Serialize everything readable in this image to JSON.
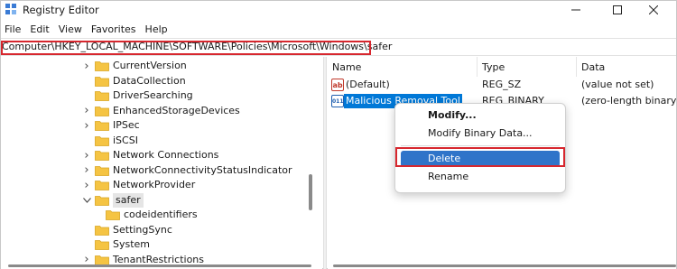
{
  "window": {
    "title": "Registry Editor",
    "minimize_glyph": "—",
    "maximize_glyph": "☐",
    "close_glyph": "✕"
  },
  "menu": [
    "File",
    "Edit",
    "View",
    "Favorites",
    "Help"
  ],
  "address": "Computer\\HKEY_LOCAL_MACHINE\\SOFTWARE\\Policies\\Microsoft\\Windows\\safer",
  "tree": {
    "items": [
      {
        "label": "CurrentVersion",
        "expander": "collapsed"
      },
      {
        "label": "DataCollection",
        "expander": "none"
      },
      {
        "label": "DriverSearching",
        "expander": "none"
      },
      {
        "label": "EnhancedStorageDevices",
        "expander": "collapsed"
      },
      {
        "label": "IPSec",
        "expander": "collapsed"
      },
      {
        "label": "iSCSI",
        "expander": "none"
      },
      {
        "label": "Network Connections",
        "expander": "collapsed"
      },
      {
        "label": "NetworkConnectivityStatusIndicator",
        "expander": "collapsed"
      },
      {
        "label": "NetworkProvider",
        "expander": "collapsed"
      },
      {
        "label": "safer",
        "expander": "expanded",
        "selected": true
      },
      {
        "label": "codeidentifiers",
        "expander": "none",
        "child": true
      },
      {
        "label": "SettingSync",
        "expander": "none"
      },
      {
        "label": "System",
        "expander": "none"
      },
      {
        "label": "TenantRestrictions",
        "expander": "collapsed"
      }
    ]
  },
  "values": {
    "columns": {
      "name": "Name",
      "type": "Type",
      "data": "Data"
    },
    "rows": [
      {
        "icon": "string-value-icon",
        "icon_text": "ab",
        "name": "(Default)",
        "type": "REG_SZ",
        "data": "(value not set)"
      },
      {
        "icon": "binary-value-icon",
        "icon_text": "011",
        "name": "Malicious Removal Tool",
        "type": "REG_BINARY",
        "data": "(zero-length binary va",
        "selected": true
      }
    ]
  },
  "context_menu": {
    "modify": "Modify...",
    "modify_binary": "Modify Binary Data...",
    "delete": "Delete",
    "rename": "Rename"
  },
  "colors": {
    "highlight_border": "#d7272e",
    "selection_blue": "#0078d7",
    "menu_selection": "#2f74c9",
    "folder_yellow": "#f5c443"
  }
}
